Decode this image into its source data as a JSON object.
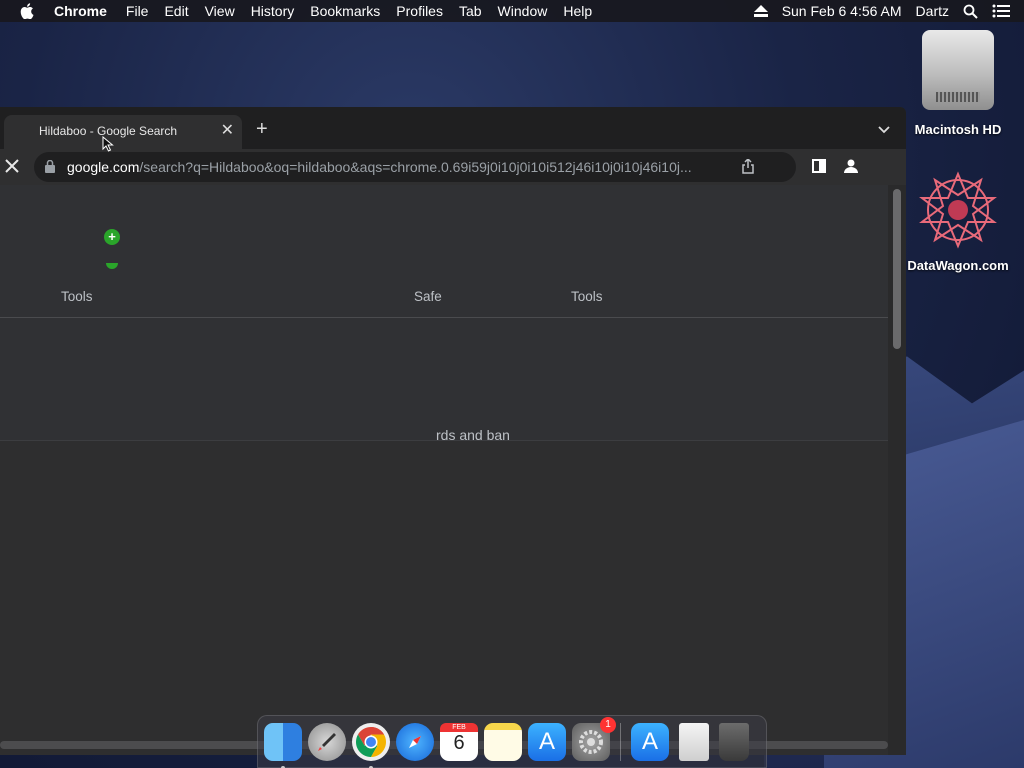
{
  "menubar": {
    "app_name": "Chrome",
    "items": [
      "File",
      "Edit",
      "View",
      "History",
      "Bookmarks",
      "Profiles",
      "Tab",
      "Window",
      "Help"
    ],
    "clock": "Sun Feb 6  4:56 AM",
    "user": "Dartz"
  },
  "desktop": {
    "icons": [
      {
        "label": "Macintosh HD",
        "icon": "hard-drive-icon"
      },
      {
        "label": "DataWagon.com",
        "icon": "datawagon-logo-icon"
      }
    ]
  },
  "browser": {
    "tab": {
      "title": "Hildaboo - Google Search"
    },
    "address": {
      "host": "google.com",
      "path": "/search?q=Hildaboo&oq=hildaboo&aqs=chrome.0.69i59j0i10j0i10i512j46i10j0i10j46i10j..."
    }
  },
  "page": {
    "tools_left": "Tools",
    "safe_partial": "Safe",
    "tools_right": "Tools",
    "snippet": "rds and ban"
  },
  "dock": {
    "apps": [
      "Finder",
      "Launchpad",
      "Google Chrome",
      "Safari",
      "Calendar",
      "Notes",
      "App Store",
      "System Preferences"
    ],
    "calendar_month": "FEB",
    "calendar_day": "6",
    "sysprefs_badge": "1"
  },
  "colors": {
    "window_bg": "#303134",
    "tabstrip_bg": "#1f1f20",
    "accent_green": "#2aa52a"
  }
}
